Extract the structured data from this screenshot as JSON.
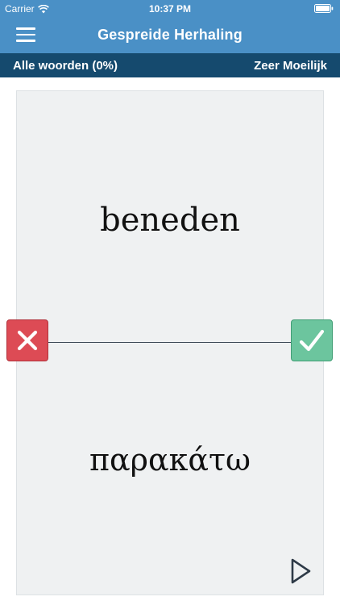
{
  "status_bar": {
    "carrier": "Carrier",
    "time": "10:37 PM"
  },
  "nav": {
    "title": "Gespreide Herhaling",
    "menu_icon": "hamburger-menu-icon"
  },
  "subheader": {
    "left_label": "Alle woorden (0%)",
    "right_label": "Zeer Moeilijk"
  },
  "card": {
    "front_word": "beneden",
    "back_word": "παρακάτω"
  },
  "actions": {
    "wrong_icon": "x-icon",
    "right_icon": "checkmark-icon",
    "play_icon": "play-icon"
  },
  "colors": {
    "nav_background": "#4a90c6",
    "subheader_background": "#154a6e",
    "card_background": "#eff1f2",
    "wrong_button": "#dd4b55",
    "right_button": "#6cc59e"
  }
}
